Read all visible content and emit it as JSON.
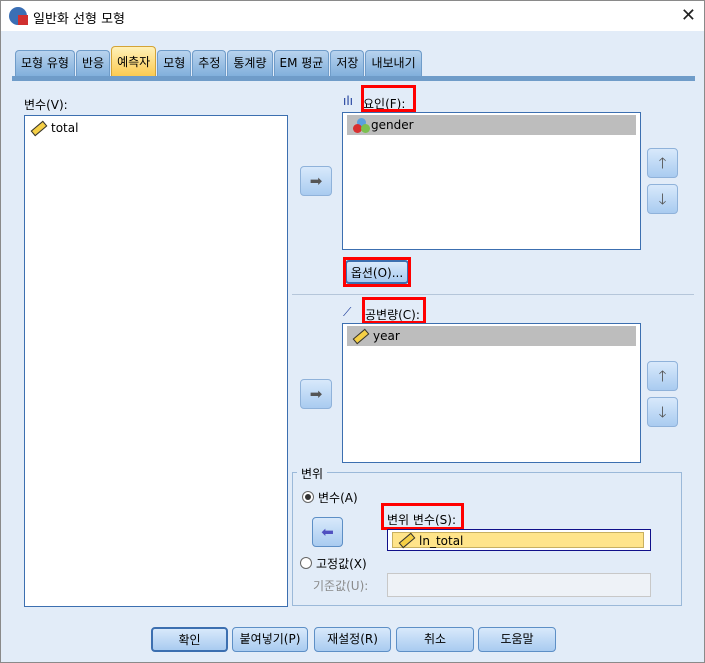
{
  "window": {
    "title": "일반화 선형 모형",
    "close": "✕"
  },
  "tabs": [
    "모형 유형",
    "반응",
    "예측자",
    "모형",
    "추정",
    "통계량",
    "EM 평균",
    "저장",
    "내보내기"
  ],
  "active_tab": "예측자",
  "variables": {
    "label": "변수(V):",
    "items": [
      "total"
    ]
  },
  "factors": {
    "label": "요인(F):",
    "items": [
      "gender"
    ],
    "options_button": "옵션(O)..."
  },
  "covariates": {
    "label": "공변량(C):",
    "items": [
      "year"
    ]
  },
  "offset": {
    "group_label": "변위",
    "radio_variable": "변수(A)",
    "offset_var_label": "변위 변수(S):",
    "offset_var_value": "ln_total",
    "radio_fixed": "고정값(X)",
    "fixed_value_label": "기준값(U):",
    "fixed_value": "",
    "selected": "variable"
  },
  "buttons": {
    "ok": "확인",
    "paste": "붙여넣기(P)",
    "reset": "재설정(R)",
    "cancel": "취소",
    "help": "도움말"
  },
  "icons": {
    "move_right": "➡",
    "move_left": "⬅",
    "up": "🡑",
    "down": "🡓"
  }
}
